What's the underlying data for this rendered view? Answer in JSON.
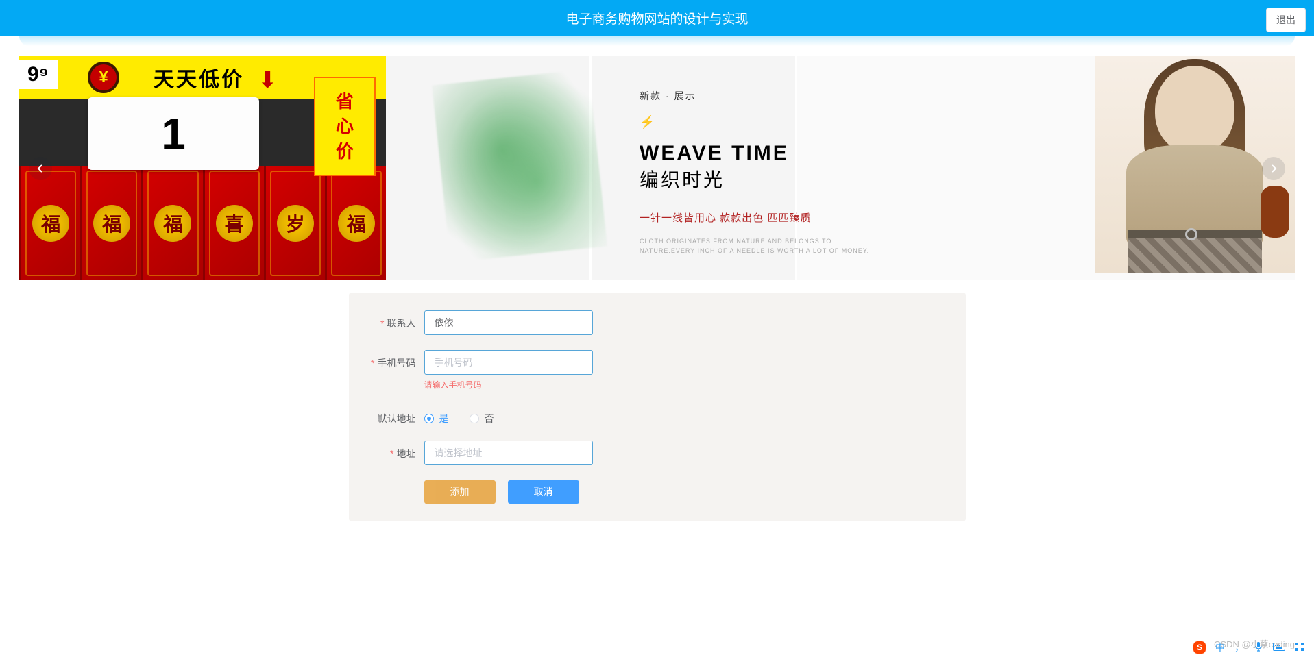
{
  "header": {
    "title": "电子商务购物网站的设计与实现",
    "logout_label": "退出"
  },
  "carousel": {
    "left": {
      "low_price_text": "天天低价",
      "price_number": "1",
      "price_badge": "9⁹",
      "vertical_text": [
        "省",
        "心",
        "价"
      ],
      "envelope_chars": [
        "福",
        "福",
        "福",
        "喜",
        "岁",
        "福"
      ]
    },
    "right": {
      "small_title": "新款 · 展示",
      "bolt_icon": "⚡",
      "title_en": "WEAVE TIME",
      "title_cn": "编织时光",
      "red_line": "一针一线皆用心 款款出色 匹匹臻质",
      "grey_line_1": "CLOTH ORIGINATES FROM NATURE AND BELONGS TO",
      "grey_line_2": "NATURE.EVERY INCH OF A NEEDLE IS WORTH A LOT OF MONEY."
    }
  },
  "form": {
    "contact": {
      "label": "联系人",
      "value": "依依"
    },
    "phone": {
      "label": "手机号码",
      "placeholder": "手机号码",
      "value": "",
      "error": "请输入手机号码"
    },
    "default_addr": {
      "label": "默认地址",
      "yes": "是",
      "no": "否",
      "selected": "yes"
    },
    "address": {
      "label": "地址",
      "placeholder": "请选择地址",
      "value": ""
    },
    "add_btn": "添加",
    "cancel_btn": "取消"
  },
  "watermark": "CSDN @小蔡coding",
  "ime": {
    "logo": "S",
    "lang": "中",
    "punc": "，"
  }
}
